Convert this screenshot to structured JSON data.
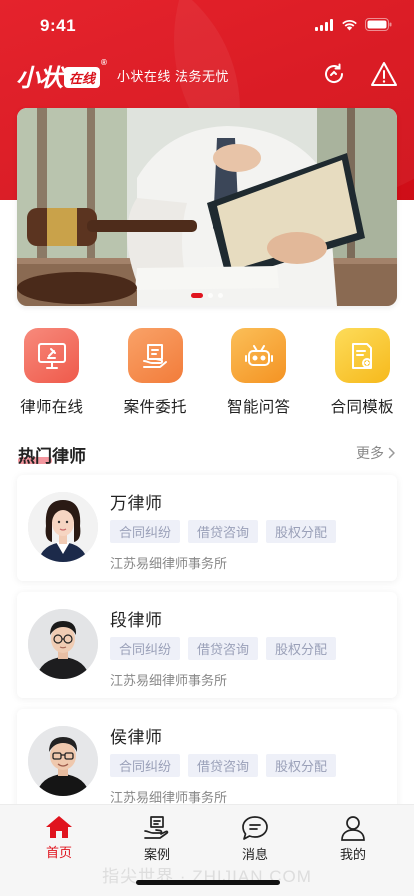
{
  "status_bar": {
    "time": "9:41"
  },
  "header": {
    "logo_text": "小状",
    "logo_badge": "在线",
    "logo_mark": "®",
    "slogan": "小状在线 法务无忧",
    "refresh_icon": "refresh-icon",
    "warning_icon": "warning-icon"
  },
  "banner": {
    "image": "lawyer-with-gavel-and-book",
    "slides": 3,
    "active_slide": 1
  },
  "quick_menu": [
    {
      "label": "律师在线",
      "icon": "monitor-gavel-icon",
      "color": "#f36b5d"
    },
    {
      "label": "案件委托",
      "icon": "document-hand-icon",
      "color": "#f58a4a"
    },
    {
      "label": "智能问答",
      "icon": "robot-icon",
      "color": "#f7a23c"
    },
    {
      "label": "合同模板",
      "icon": "contract-icon",
      "color": "#f7c534"
    }
  ],
  "section": {
    "title": "热门律师",
    "more": "更多",
    "accent": "#e94250"
  },
  "lawyers": [
    {
      "name": "万律师",
      "tags": [
        "合同纠纷",
        "借贷咨询",
        "股权分配"
      ],
      "firm": "江苏易细律师事务所",
      "avatar": "female-lawyer-avatar"
    },
    {
      "name": "段律师",
      "tags": [
        "合同纠纷",
        "借贷咨询",
        "股权分配"
      ],
      "firm": "江苏易细律师事务所",
      "avatar": "male-lawyer-avatar"
    },
    {
      "name": "侯律师",
      "tags": [
        "合同纠纷",
        "借贷咨询",
        "股权分配"
      ],
      "firm": "江苏易细律师事务所",
      "avatar": "male-lawyer-avatar"
    }
  ],
  "bottom_nav": [
    {
      "label": "首页",
      "icon": "home-icon",
      "active": true
    },
    {
      "label": "案例",
      "icon": "hand-document-icon",
      "active": false
    },
    {
      "label": "消息",
      "icon": "chat-bubble-icon",
      "active": false
    },
    {
      "label": "我的",
      "icon": "user-icon",
      "active": false
    }
  ],
  "watermark": "指尖世界 · ZHIJIAN.COM",
  "colors": {
    "brand_red": "#e0141e",
    "tag_bg": "#eef0f8",
    "tag_text": "#9aa0b8"
  }
}
